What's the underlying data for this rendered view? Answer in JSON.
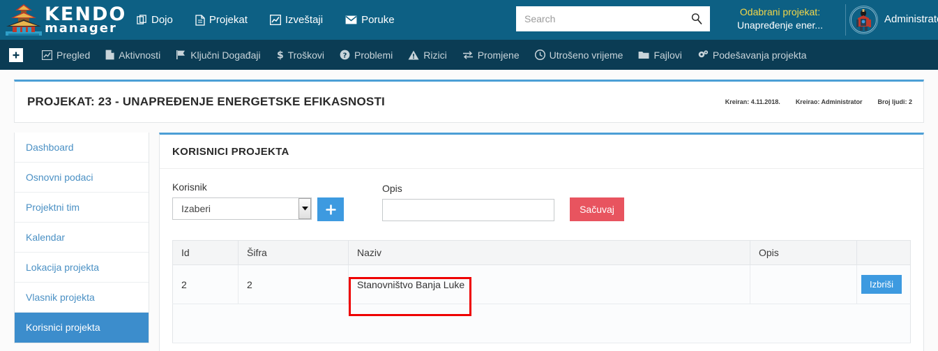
{
  "header": {
    "logo_primary": "KENDO",
    "logo_secondary": "manager",
    "logo_icon": "pagoda-logo-icon",
    "nav": [
      {
        "label": "Dojo",
        "icon": "copy-icon"
      },
      {
        "label": "Projekat",
        "icon": "document-icon"
      },
      {
        "label": "Izveštaji",
        "icon": "chart-line-icon"
      },
      {
        "label": "Poruke",
        "icon": "envelope-icon"
      }
    ],
    "search": {
      "placeholder": "Search",
      "value": "",
      "icon": "search-icon"
    },
    "selected_project": {
      "label": "Odabrani projekat:",
      "value": "Unapređenje ener...",
      "label_color": "#f3d74a"
    },
    "user": {
      "name": "Administrator",
      "avatar_icon": "kendo-warrior-avatar-icon"
    },
    "background_color": "#0d6084"
  },
  "subnav": {
    "background_color": "#0b3c54",
    "add_button_icon": "plus-square-icon",
    "items": [
      {
        "label": "Pregled",
        "icon": "chart-line-icon"
      },
      {
        "label": "Aktivnosti",
        "icon": "file-icon"
      },
      {
        "label": "Ključni Događaji",
        "icon": "flag-icon"
      },
      {
        "label": "Troškovi",
        "icon": "dollar-icon"
      },
      {
        "label": "Problemi",
        "icon": "question-circle-icon"
      },
      {
        "label": "Rizici",
        "icon": "warning-triangle-icon"
      },
      {
        "label": "Promjene",
        "icon": "exchange-arrows-icon"
      },
      {
        "label": "Utrošeno vrijeme",
        "icon": "clock-icon"
      },
      {
        "label": "Fajlovi",
        "icon": "folder-icon"
      },
      {
        "label": "Podešavanja projekta",
        "icon": "gears-icon"
      }
    ]
  },
  "project_bar": {
    "title": "PROJEKAT: 23 - UNAPREĐENJE ENERGETSKE EFIKASNOSTI",
    "meta": [
      "Kreiran: 4.11.2018.",
      "Kreirao: Administrator",
      "Broj ljudi: 2"
    ]
  },
  "sidebar": {
    "items": [
      {
        "label": "Dashboard",
        "active": false
      },
      {
        "label": "Osnovni podaci",
        "active": false
      },
      {
        "label": "Projektni tim",
        "active": false
      },
      {
        "label": "Kalendar",
        "active": false
      },
      {
        "label": "Lokacija projekta",
        "active": false
      },
      {
        "label": "Vlasnik projekta",
        "active": false
      },
      {
        "label": "Korisnici projekta",
        "active": true
      }
    ],
    "active_color": "#3c8dcc",
    "link_color": "#4a90c4"
  },
  "panel": {
    "title": "KORISNICI PROJEKTA",
    "form": {
      "korisnik_label": "Korisnik",
      "korisnik_value": "Izaberi",
      "korisnik_dropdown_icon": "chevron-down-icon",
      "add_button_icon": "plus-icon",
      "add_button_color": "#3d9ae0",
      "opis_label": "Opis",
      "opis_value": "",
      "opis_placeholder": "",
      "save_label": "Sačuvaj",
      "save_color": "#e8545f"
    },
    "table": {
      "columns": [
        "Id",
        "Šifra",
        "Naziv",
        "Opis",
        ""
      ],
      "rows": [
        {
          "id": "2",
          "sifra": "2",
          "naziv": "Stanovništvo Banja Luke",
          "opis": "",
          "action_label": "Izbriši",
          "action_color": "#3d9ae0"
        }
      ]
    }
  },
  "annotation": {
    "highlight_color": "#ee0000",
    "highlight_target": "Stanovništvo Banja Luke"
  }
}
